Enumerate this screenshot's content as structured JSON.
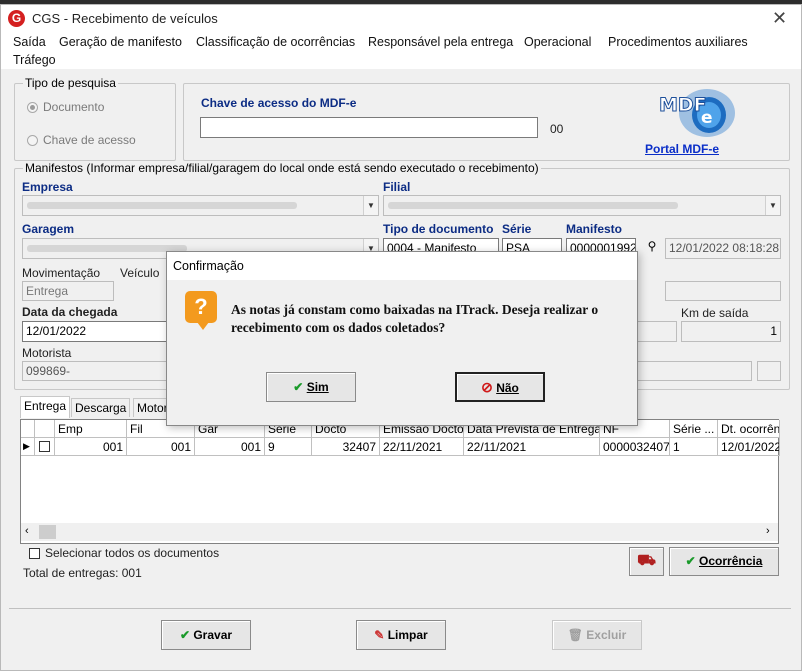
{
  "window": {
    "title": "CGS - Recebimento de veículos",
    "app_icon_letter": "G",
    "close_glyph": "✕"
  },
  "menu": [
    "Saída",
    "Geração de manifesto",
    "Classificação de ocorrências",
    "Responsável pela entrega",
    "Operacional",
    "Procedimentos auxiliares",
    "Tráfego"
  ],
  "search_type": {
    "title": "Tipo de pesquisa",
    "options": [
      {
        "label": "Documento",
        "selected": true
      },
      {
        "label": "Chave de acesso",
        "selected": false
      }
    ]
  },
  "access_key": {
    "label": "Chave de acesso do MDF-e",
    "value": "",
    "suffix": "00"
  },
  "portal_link": "Portal MDF-e",
  "manifests": {
    "title": "Manifestos (Informar empresa/filial/garagem do local onde está sendo executado o recebimento)",
    "empresa_label": "Empresa",
    "filial_label": "Filial",
    "garagem_label": "Garagem",
    "tipo_doc_label": "Tipo de documento",
    "serie_label": "Série",
    "manifesto_label": "Manifesto",
    "tipo_doc_value": "0004 - Manifesto",
    "serie_value": "PSA",
    "manifesto_value": "0000001992",
    "manifesto_datetime": "12/01/2022 08:18:28",
    "movimentacao_label": "Movimentação",
    "movimentacao_value": "Entrega",
    "veiculo_label": "Veículo",
    "data_chegada_label": "Data da chegada",
    "data_chegada_value": "12/01/2022",
    "km_saida_label": "Km de saída",
    "km_saida_value": "1",
    "motorista_label": "Motorista",
    "motorista_value": "099869-"
  },
  "tabs": [
    "Entrega",
    "Descarga",
    "Motor"
  ],
  "grid": {
    "headers": [
      "Emp",
      "Fil",
      "Gar",
      "Série",
      "Docto",
      "Emissão Docto",
      "Data Prevista de Entrega",
      "NF",
      "Série ...",
      "Dt. ocorrênc"
    ],
    "rows": [
      [
        "001",
        "001",
        "001",
        "9",
        "32407",
        "22/11/2021",
        "22/11/2021",
        "0000032407",
        "1",
        "12/01/2022"
      ]
    ]
  },
  "select_all_label": "Selecionar todos os documentos",
  "total_label": "Total de entregas: 001",
  "buttons": {
    "ocorrencia": "Ocorrência",
    "gravar": "Gravar",
    "limpar": "Limpar",
    "excluir": "Excluir"
  },
  "dialog": {
    "title": "Confirmação",
    "message": "As notas já constam como baixadas na ITrack. Deseja realizar o recebimento com os dados coletados?",
    "yes": "Sim",
    "no": "Não"
  }
}
